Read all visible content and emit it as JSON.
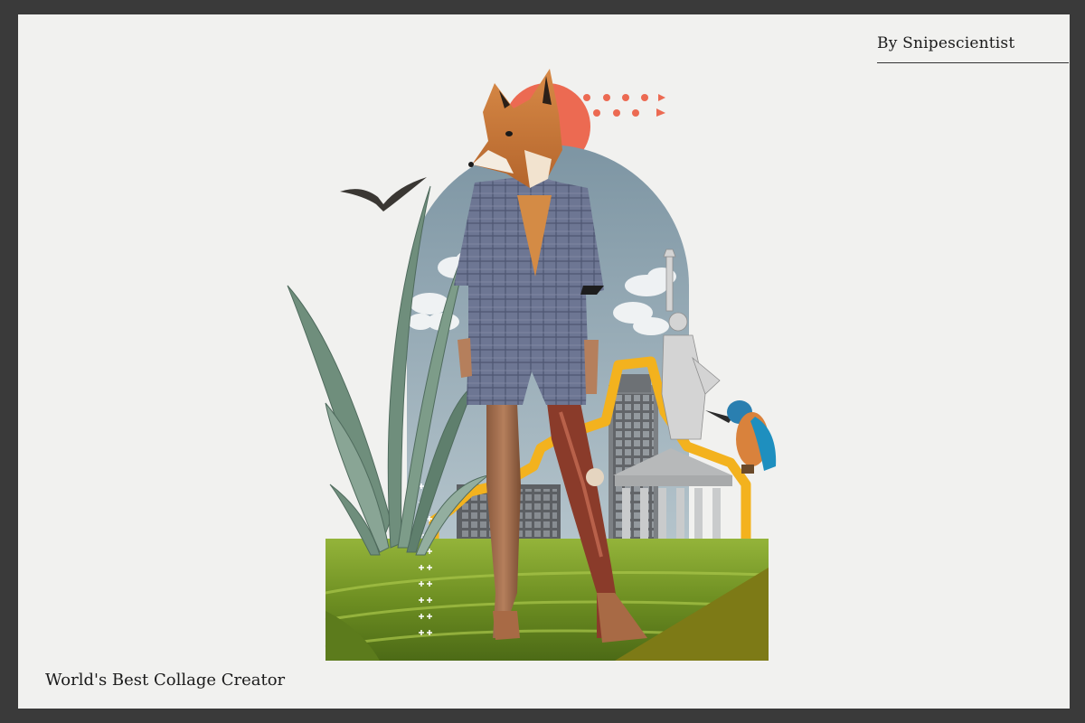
{
  "byline": {
    "text": "By Snipescientist"
  },
  "caption": {
    "text": "World's Best Collage Creator"
  },
  "artwork": {
    "subject": "fox-headed woman in plaid suit",
    "elements": [
      "fox-head",
      "woman-figure",
      "anatomy-leg",
      "statue-of-liberty",
      "kingfisher",
      "eagle",
      "agave-plant",
      "skyscraper",
      "classical-building",
      "clouds",
      "green-field",
      "red-sun",
      "coral-dots",
      "yellow-outline"
    ]
  },
  "colors": {
    "frame": "#f1f1ef",
    "border": "#3a3a3a",
    "sky": "#8ea4b0",
    "sun": "#ec6a52",
    "accent_yellow": "#f3b21e",
    "grass": "#7a9a2a",
    "suit": "#6c7590"
  }
}
